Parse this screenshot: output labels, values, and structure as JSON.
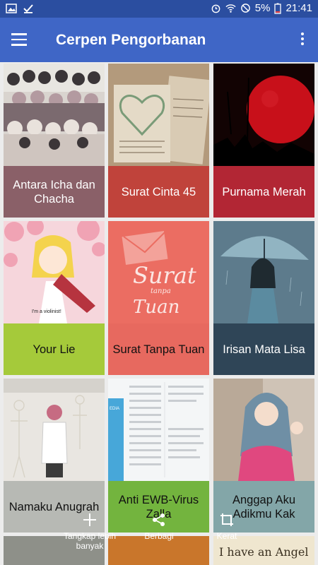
{
  "status_bar": {
    "battery": "5%",
    "time": "21:41"
  },
  "app_bar": {
    "title": "Cerpen Pengorbanan"
  },
  "stories": [
    {
      "title": "Antara Icha dan Chacha",
      "color": "#8a6068"
    },
    {
      "title": "Surat Cinta 45",
      "color": "#c0433b"
    },
    {
      "title": "Purnama Merah",
      "color": "#b22634"
    },
    {
      "title": "Your Lie",
      "color": "#a5ca3a"
    },
    {
      "title": "Surat Tanpa Tuan",
      "color": "#e7695f"
    },
    {
      "title": "Irisan Mata Lisa",
      "color": "#2f4557"
    },
    {
      "title": "Namaku Anugrah",
      "color": "#b7b9b4"
    },
    {
      "title": "Anti EWB-Virus Zalla",
      "color": "#73b43e"
    },
    {
      "title": "Anggap Aku Adikmu Kak",
      "color": "#83a6a8"
    }
  ],
  "cover_text": {
    "surat_tanpa_tuan": "Surat tanpa Tuan",
    "your_lie_caption": "I'm a violinist!",
    "angel": "I have an Angel"
  },
  "screenshot_toolbar": {
    "capture_more": "Tangkap lebih banyak",
    "share": "Berbagi",
    "crop": "Kerat"
  }
}
